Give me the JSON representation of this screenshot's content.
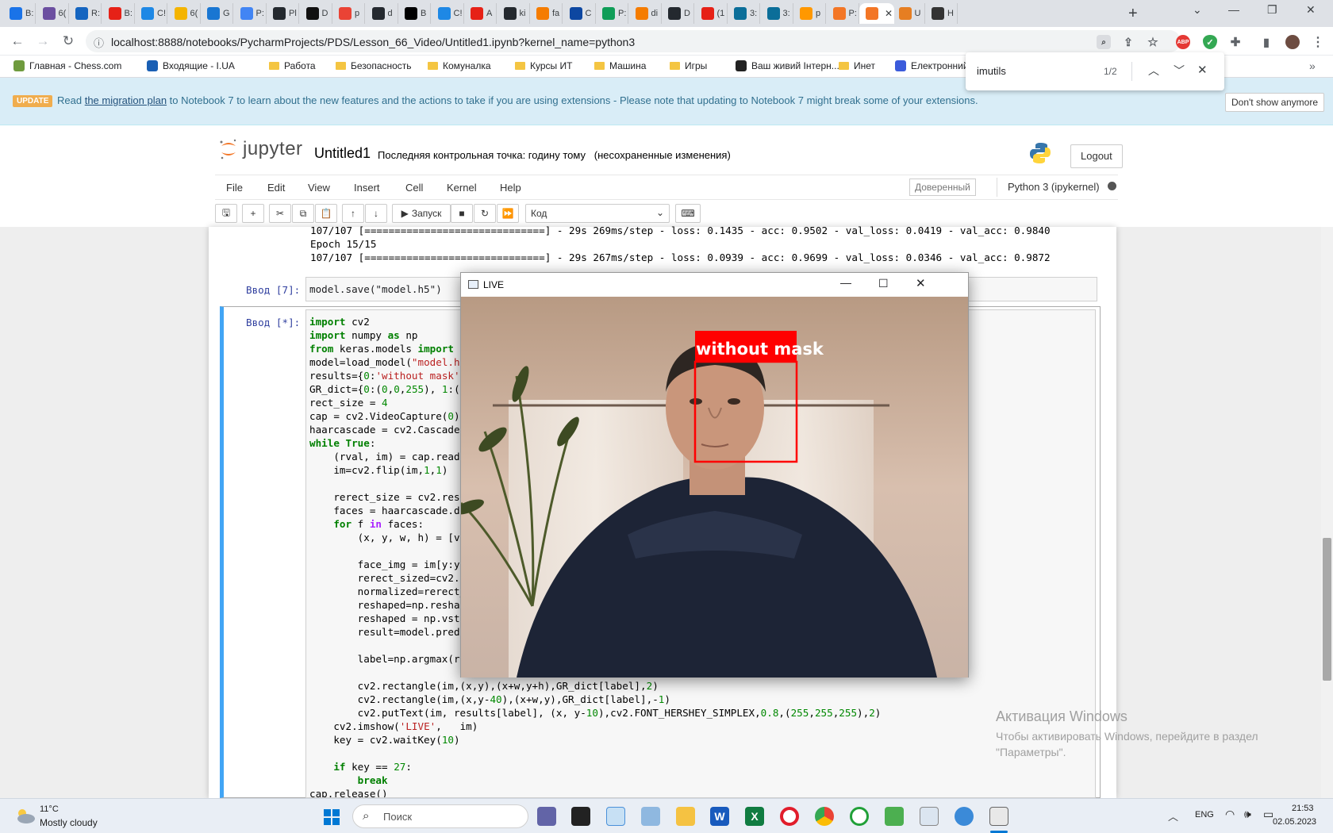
{
  "browser": {
    "tabs": [
      {
        "label": "B:",
        "color": "#1a73e8"
      },
      {
        "label": "6(",
        "color": "#6b4fa0"
      },
      {
        "label": "R:",
        "color": "#1565c0"
      },
      {
        "label": "B:",
        "color": "#e62117"
      },
      {
        "label": "C!",
        "color": "#1e88e5"
      },
      {
        "label": "6(",
        "color": "#f4b400"
      },
      {
        "label": "G",
        "color": "#1976d2"
      },
      {
        "label": "P:",
        "color": "#4285f4"
      },
      {
        "label": "Pl",
        "color": "#24292f"
      },
      {
        "label": "D",
        "color": "#111111"
      },
      {
        "label": "p",
        "color": "#ea4335"
      },
      {
        "label": "d",
        "color": "#24292f"
      },
      {
        "label": "B",
        "color": "#000000"
      },
      {
        "label": "C!",
        "color": "#1e88e5"
      },
      {
        "label": "A",
        "color": "#e62117"
      },
      {
        "label": "ki",
        "color": "#24292f"
      },
      {
        "label": "fa",
        "color": "#f57c00"
      },
      {
        "label": "C",
        "color": "#0d47a1"
      },
      {
        "label": "P:",
        "color": "#0f9d58"
      },
      {
        "label": "di",
        "color": "#f57c00"
      },
      {
        "label": "D",
        "color": "#24292f"
      },
      {
        "label": "(1",
        "color": "#e62117"
      },
      {
        "label": "3:",
        "color": "#0b6e99"
      },
      {
        "label": "3:",
        "color": "#0b6e99"
      },
      {
        "label": "p",
        "color": "#ff9800"
      },
      {
        "label": "P:",
        "color": "#f37626"
      },
      {
        "label": "",
        "color": "#f37626",
        "active": true
      },
      {
        "label": "U",
        "color": "#e67e22"
      },
      {
        "label": "H",
        "color": "#333333"
      }
    ],
    "url": "localhost:8888/notebooks/PycharmProjects/PDS/Lesson_66_Video/Untitled1.ipynb?kernel_name=python3",
    "bookmarks": [
      {
        "label": "Главная - Chess.com",
        "icon": "chess-icon"
      },
      {
        "label": "Входящие - I.UA",
        "icon": "mail-icon"
      },
      {
        "label": "Работа",
        "icon": "folder-icon"
      },
      {
        "label": "Безопасность",
        "icon": "folder-icon"
      },
      {
        "label": "Комуналка",
        "icon": "folder-icon"
      },
      {
        "label": "Курсы ИТ",
        "icon": "folder-icon"
      },
      {
        "label": "Машина",
        "icon": "folder-icon"
      },
      {
        "label": "Игры",
        "icon": "folder-icon"
      },
      {
        "label": "Ваш живий Інтерн...",
        "icon": "site-icon"
      },
      {
        "label": "Инет",
        "icon": "folder-icon"
      },
      {
        "label": "Електронний кабін...",
        "icon": "doc-icon"
      }
    ],
    "find": {
      "query": "imutils",
      "count": "1/2"
    }
  },
  "banner": {
    "badge": "UPDATE",
    "pre": "Read ",
    "link": "the migration plan",
    "post": " to Notebook 7 to learn about the new features and the actions to take if you are using extensions - Please note that updating to Notebook 7 might break some of your extensions.",
    "dismiss": "Don't show anymore"
  },
  "jupyter": {
    "logo": "jupyter",
    "notebook_name": "Untitled1",
    "checkpoint": "Последняя контрольная точка: годину тому   (несохраненные изменения)",
    "logout": "Logout",
    "menus": [
      "File",
      "Edit",
      "View",
      "Insert",
      "Cell",
      "Kernel",
      "Help"
    ],
    "trusted": "Доверенный",
    "kernel": "Python 3 (ipykernel)",
    "run_label": "Запуск",
    "cell_type": "Код"
  },
  "notebook": {
    "output_lines": [
      "107/107 [==============================] - 29s 269ms/step - loss: 0.1435 - acc: 0.9502 - val_loss: 0.0419 - val_acc: 0.9840",
      "Epoch 15/15",
      "107/107 [==============================] - 29s 267ms/step - loss: 0.0939 - acc: 0.9699 - val_loss: 0.0346 - val_acc: 0.9872"
    ],
    "cell7_prompt": "Ввод [7]:",
    "cell7_code": "model.save(\"model.h5\")",
    "current_prompt": "Ввод [*]:"
  },
  "live_window": {
    "title": "LIVE",
    "overlay_label": "without mask"
  },
  "activation": {
    "title": "Активация Windows",
    "text": "Чтобы активировать Windows, перейдите в раздел \"Параметры\"."
  },
  "taskbar": {
    "temperature": "11°C",
    "weather": "Mostly cloudy",
    "search": "Поиск",
    "lang": "ENG",
    "time": "21:53",
    "date": "02.05.2023"
  }
}
